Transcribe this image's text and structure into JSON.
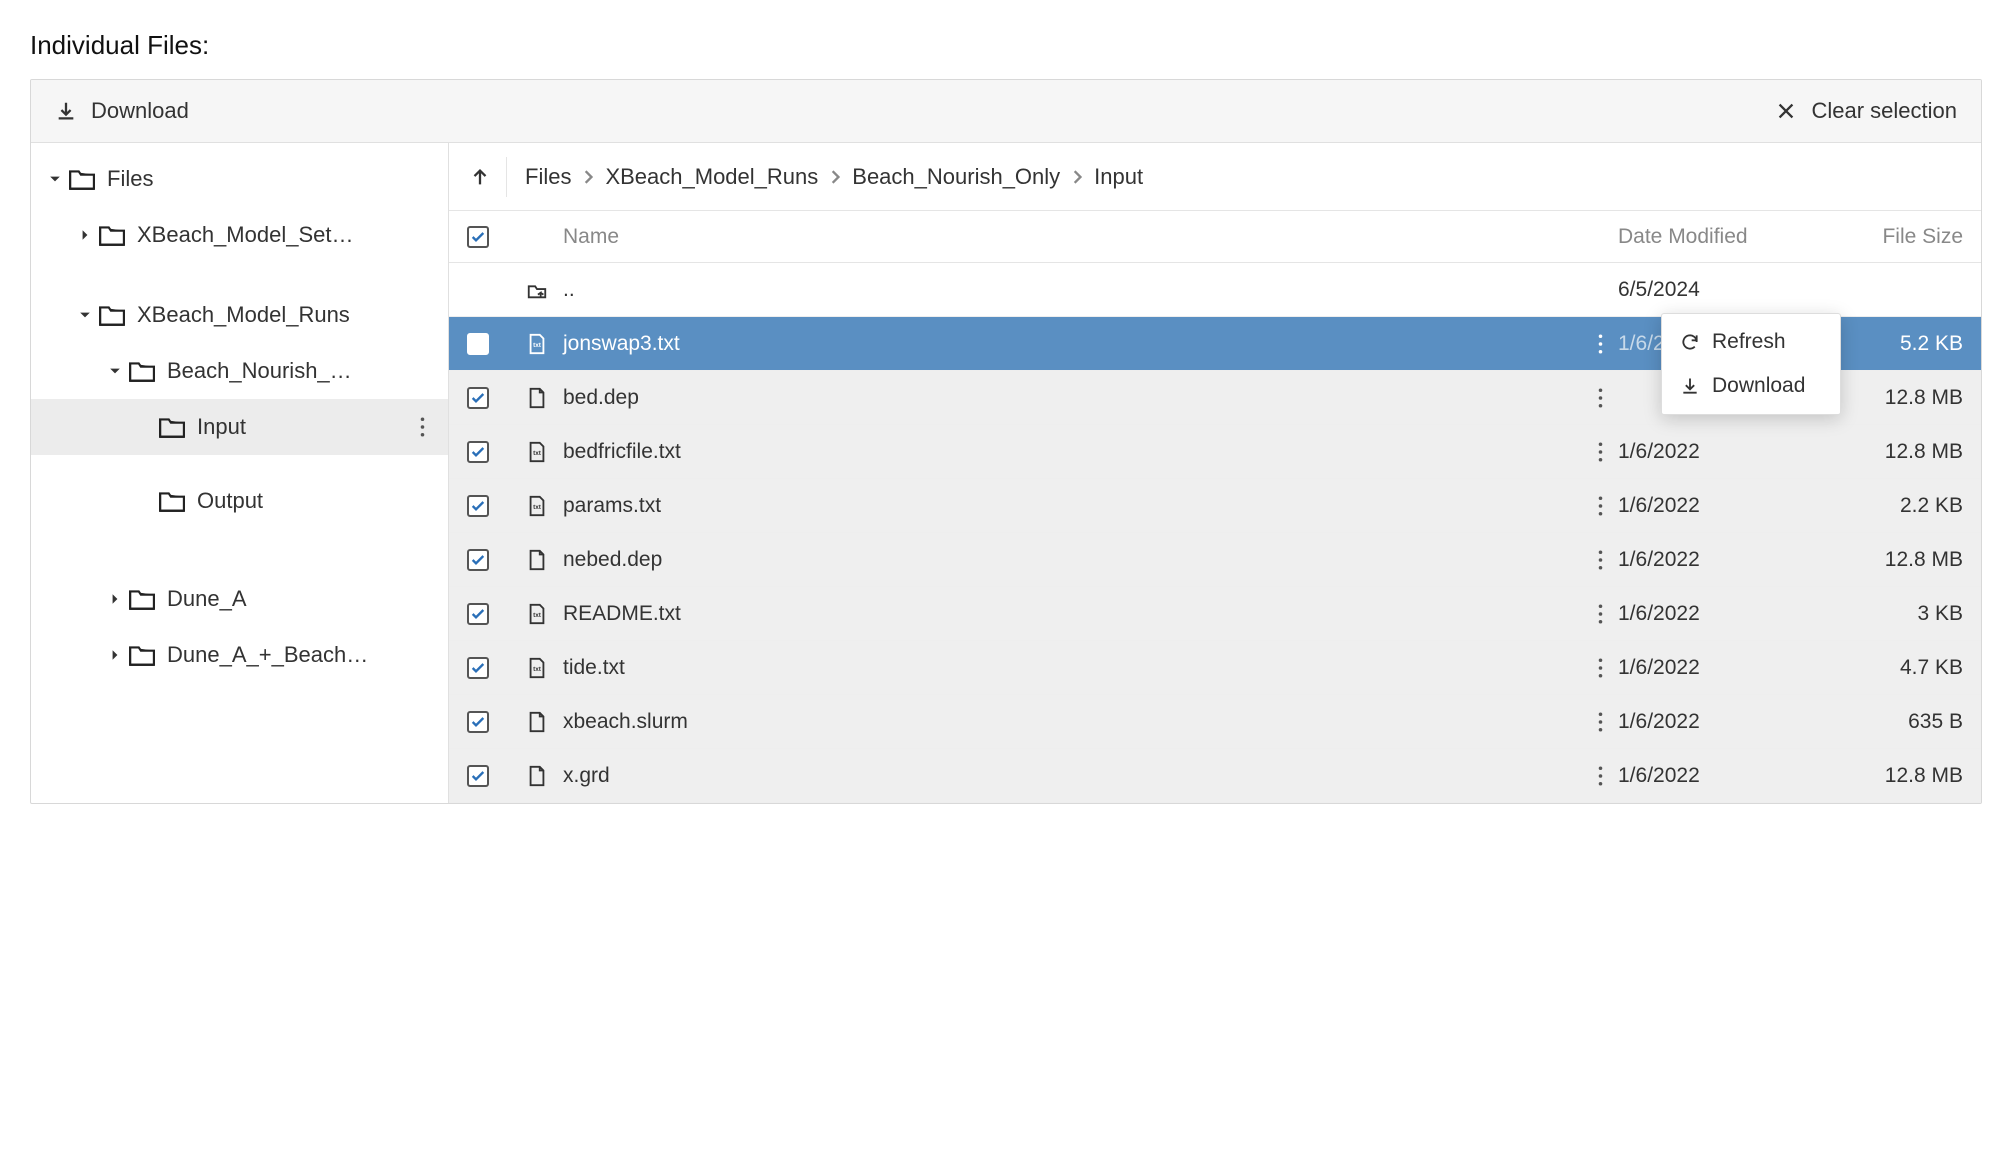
{
  "page_title": "Individual Files:",
  "toolbar": {
    "download_label": "Download",
    "clear_label": "Clear selection"
  },
  "tree": [
    {
      "label": "Files",
      "indent": 0,
      "expanded": true,
      "caret": "down"
    },
    {
      "label": "XBeach_Model_Set…",
      "indent": 1,
      "caret": "right"
    },
    {
      "label": "XBeach_Model_Runs",
      "indent": 1,
      "caret": "down"
    },
    {
      "label": "Beach_Nourish_…",
      "indent": 2,
      "caret": "down"
    },
    {
      "label": "Input",
      "indent": 3,
      "caret": "none",
      "active": true,
      "kebab": true
    },
    {
      "label": "Output",
      "indent": 3,
      "caret": "none"
    },
    {
      "label": "Dune_A",
      "indent": 2,
      "caret": "right"
    },
    {
      "label": "Dune_A_+_Beach…",
      "indent": 2,
      "caret": "right"
    }
  ],
  "breadcrumbs": [
    "Files",
    "XBeach_Model_Runs",
    "Beach_Nourish_Only",
    "Input"
  ],
  "columns": {
    "name": "Name",
    "date": "Date Modified",
    "size": "File Size"
  },
  "rows": [
    {
      "icon": "up",
      "name": "..",
      "date": "6/5/2024",
      "size": "",
      "checkable": false,
      "bg": "white"
    },
    {
      "icon": "txt",
      "name": "jonswap3.txt",
      "date": "1/6/2022",
      "size": "5.2 KB",
      "checked": true,
      "selected": true,
      "context": true
    },
    {
      "icon": "file",
      "name": "bed.dep",
      "date": "",
      "size": "12.8 MB",
      "checked": true,
      "bg": "alt",
      "menu": true
    },
    {
      "icon": "txt",
      "name": "bedfricfile.txt",
      "date": "1/6/2022",
      "size": "12.8 MB",
      "checked": true,
      "bg": "alt",
      "menu": true
    },
    {
      "icon": "txt",
      "name": "params.txt",
      "date": "1/6/2022",
      "size": "2.2 KB",
      "checked": true,
      "bg": "alt",
      "menu": true
    },
    {
      "icon": "file",
      "name": "nebed.dep",
      "date": "1/6/2022",
      "size": "12.8 MB",
      "checked": true,
      "bg": "alt",
      "menu": true
    },
    {
      "icon": "txt",
      "name": "README.txt",
      "date": "1/6/2022",
      "size": "3 KB",
      "checked": true,
      "bg": "alt",
      "menu": true
    },
    {
      "icon": "txt",
      "name": "tide.txt",
      "date": "1/6/2022",
      "size": "4.7 KB",
      "checked": true,
      "bg": "alt",
      "menu": true
    },
    {
      "icon": "file",
      "name": "xbeach.slurm",
      "date": "1/6/2022",
      "size": "635 B",
      "checked": true,
      "bg": "alt",
      "menu": true
    },
    {
      "icon": "file",
      "name": "x.grd",
      "date": "1/6/2022",
      "size": "12.8 MB",
      "checked": true,
      "bg": "alt",
      "menu": true
    }
  ],
  "context_menu": {
    "refresh": "Refresh",
    "download": "Download"
  },
  "header_checked": true
}
